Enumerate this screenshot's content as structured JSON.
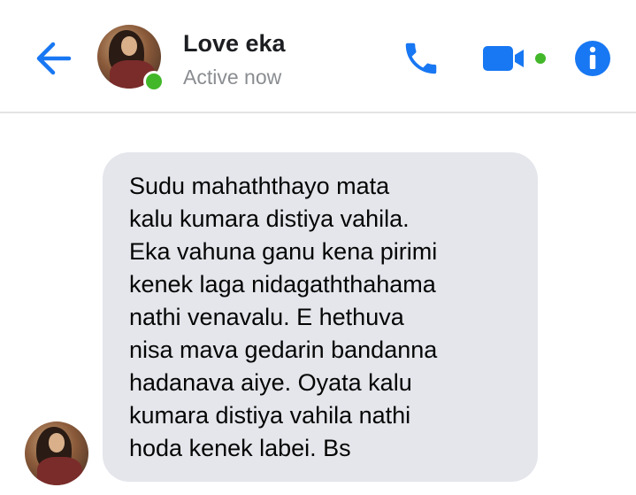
{
  "header": {
    "contact_name": "Love eka",
    "status": "Active now",
    "icons": {
      "back": "back-arrow-icon",
      "call": "phone-icon",
      "video": "video-camera-icon",
      "info": "info-icon"
    },
    "accent_color": "#1877f2",
    "online_color": "#42b72a"
  },
  "message": {
    "bubble_color": "#e4e6eb",
    "lines": [
      "Sudu mahaththayo mata",
      "kalu kumara distiya vahila.",
      "Eka vahuna ganu kena pirimi",
      "kenek laga nidagaththahama",
      "nathi venavalu. E hethuva",
      "nisa mava gedarin bandanna",
      "hadanava aiye. Oyata kalu",
      "kumara distiya vahila nathi",
      "hoda kenek labei. Bs"
    ]
  }
}
